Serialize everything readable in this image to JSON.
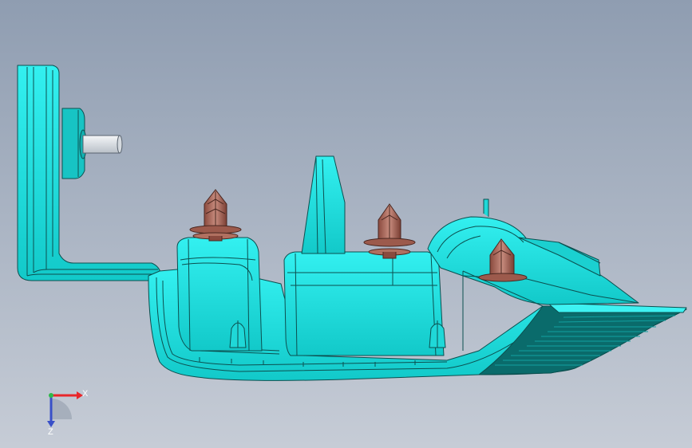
{
  "viewport": {
    "background_top": "#8f9db1",
    "background_bottom": "#c6ccd6"
  },
  "model": {
    "body_color": "#1ee6e6",
    "body_dark": "#10a3a3",
    "clip_color": "#b47d70",
    "clip_dark": "#5c3328",
    "pin_color": "#e2e6ea"
  },
  "triad": {
    "x_label": "X",
    "z_label": "Z",
    "x_color": "#e8262a",
    "y_color": "#2fb84a",
    "z_color": "#3950c8"
  }
}
